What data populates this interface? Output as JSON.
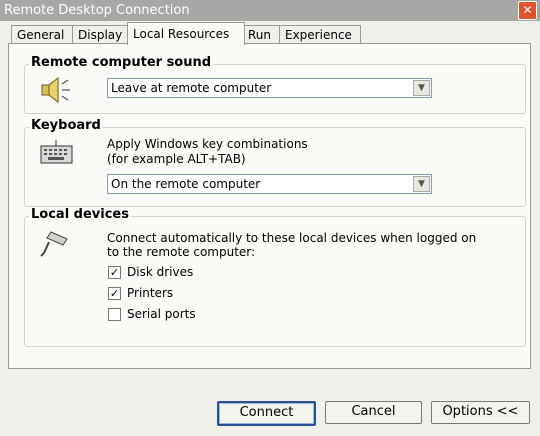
{
  "window": {
    "title": "Remote Desktop Connection"
  },
  "tabs": [
    "General",
    "Display",
    "Local Resources",
    "Run",
    "Experience"
  ],
  "sound": {
    "group_label": "Remote computer sound",
    "selected": "Leave at remote computer"
  },
  "keyboard": {
    "group_label": "Keyboard",
    "line1": "Apply Windows key combinations",
    "line2": "(for example ALT+TAB)",
    "selected": "On the remote computer"
  },
  "devices": {
    "group_label": "Local devices",
    "line1": "Connect automatically to these local devices when logged on",
    "line2": "to the remote computer:",
    "items": [
      {
        "label": "Disk drives",
        "checked": true
      },
      {
        "label": "Printers",
        "checked": true
      },
      {
        "label": "Serial ports",
        "checked": false
      }
    ]
  },
  "buttons": {
    "connect": "Connect",
    "cancel": "Cancel",
    "options": "Options <<"
  },
  "icons": {
    "close": "close-icon",
    "dropdown": "dropdown-arrow-icon",
    "speaker": "speaker-icon",
    "keyboard": "keyboard-icon",
    "device": "plug-icon"
  }
}
